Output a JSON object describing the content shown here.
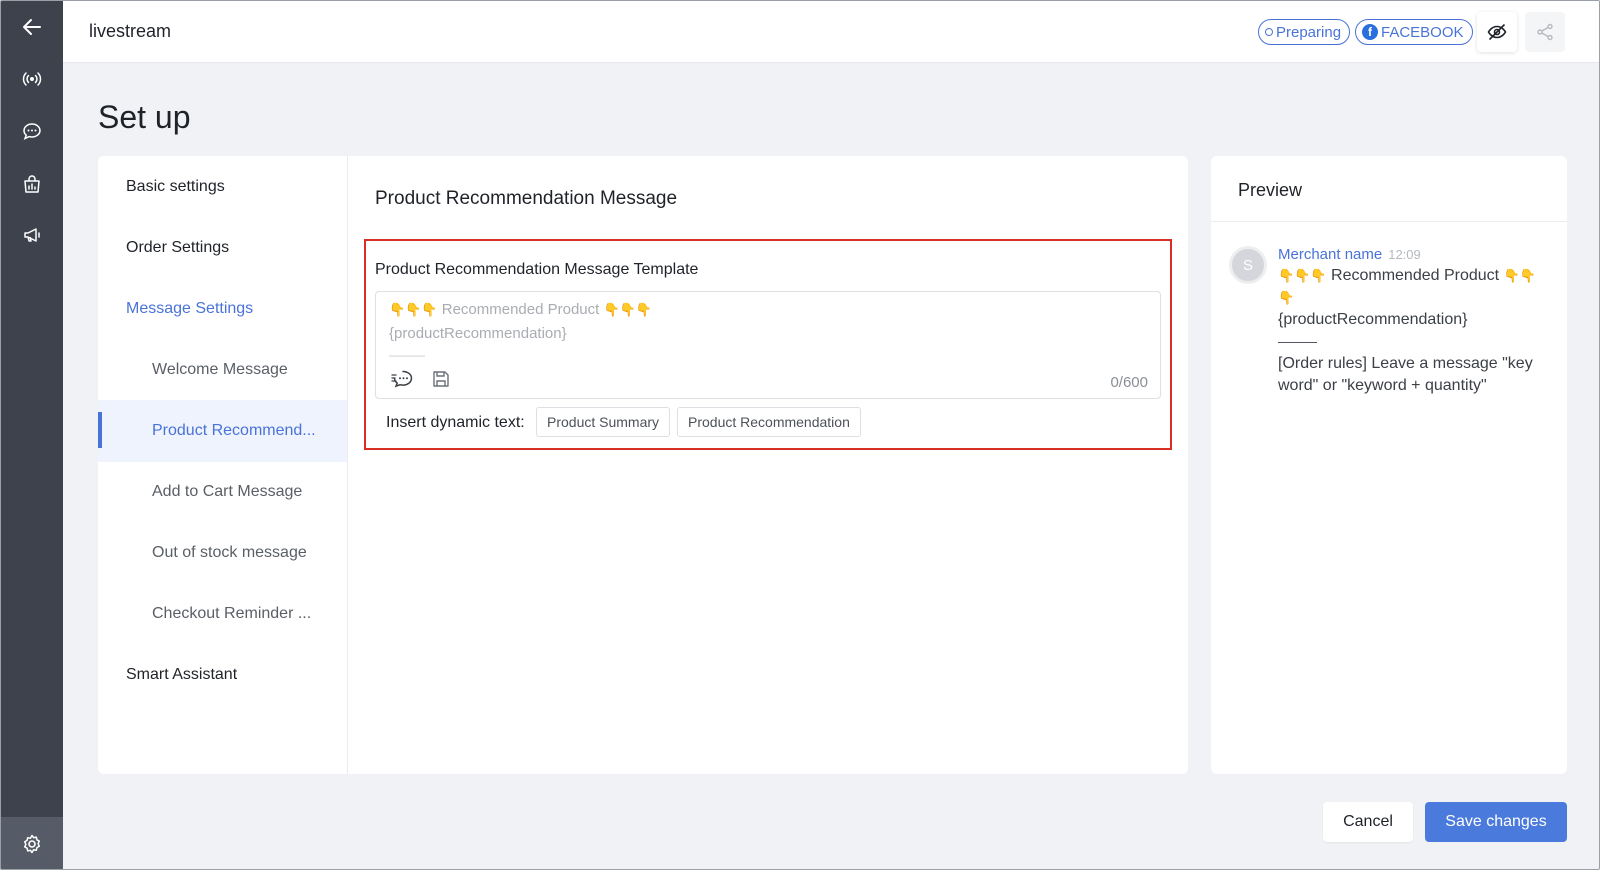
{
  "header": {
    "title": "livestream",
    "status_badge": "Preparing",
    "platform_badge": "FACEBOOK",
    "platform_logo": "f"
  },
  "page": {
    "title": "Set up"
  },
  "subnav": {
    "basic": "Basic settings",
    "order": "Order Settings",
    "message": "Message Settings",
    "welcome": "Welcome Message",
    "product_recommendation": "Product Recommend...",
    "add_to_cart": "Add to Cart Message",
    "out_of_stock": "Out of stock message",
    "checkout_reminder": "Checkout Reminder ...",
    "smart_assistant": "Smart Assistant"
  },
  "main": {
    "section_title": "Product Recommendation Message",
    "template_label": "Product Recommendation Message Template",
    "editor": {
      "hand_emoji": "👇👇👇",
      "line1_text": "Recommended Product",
      "line2": "{productRecommendation}",
      "line3": "———",
      "counter": "0/600"
    },
    "dynamic_label": "Insert dynamic text:",
    "dynamic_buttons": [
      "Product Summary",
      "Product Recommendation"
    ]
  },
  "preview": {
    "title": "Preview",
    "avatar_initial": "S",
    "merchant_name": "Merchant name",
    "time": "12:09",
    "hand_emoji_3": "👇👇👇",
    "hand_emoji_2": "👇👇",
    "hand_emoji_1": "👇",
    "line1_text": "Recommended Product",
    "line2": "{productRecommendation}",
    "line3": "———",
    "line4": "[Order rules] Leave a message \"key word\" or \"keyword + quantity\""
  },
  "footer": {
    "cancel": "Cancel",
    "save": "Save changes"
  },
  "colors": {
    "accent": "#4a73d8",
    "highlight_border": "#d93025",
    "rail": "#3d424d"
  }
}
